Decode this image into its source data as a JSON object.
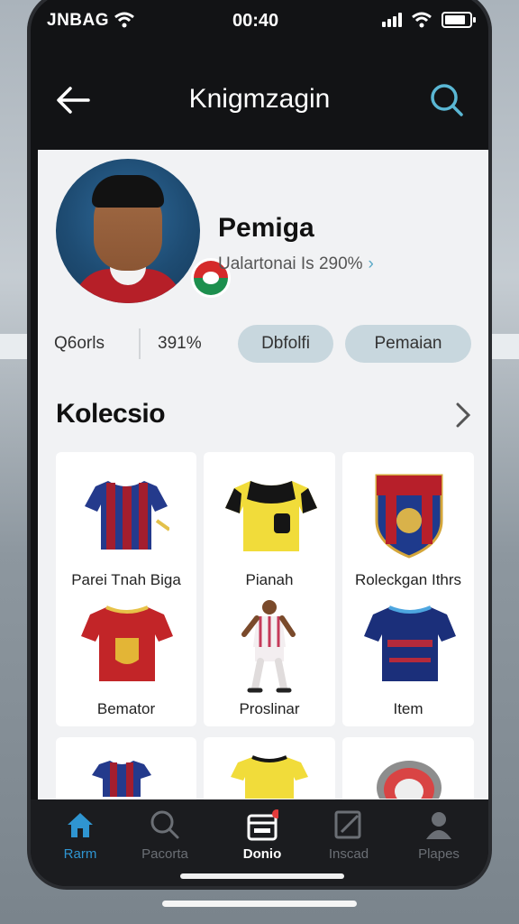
{
  "status_bar": {
    "carrier": "JNBAG",
    "time": "00:40"
  },
  "header": {
    "title": "Knigmzagin"
  },
  "profile": {
    "name": "Pemiga",
    "subtitle": "Ualartonai Is 290%",
    "stats": [
      {
        "value": "Q6orls"
      },
      {
        "value": "391%"
      }
    ],
    "buttons": [
      {
        "label": "Dbfolfi"
      },
      {
        "label": "Pemaian"
      }
    ]
  },
  "collection": {
    "title": "Kolecsio",
    "items": [
      {
        "label": "Parei Tnah Biga",
        "icon": "jersey-striped-icon"
      },
      {
        "label": "Pianah",
        "icon": "jersey-yellow-icon"
      },
      {
        "label": "Roleckgan Ithrs",
        "icon": "club-crest-icon"
      },
      {
        "label": "Bemator",
        "icon": "jersey-red-icon"
      },
      {
        "label": "Proslinar",
        "icon": "player-figure-icon"
      },
      {
        "label": "Item",
        "icon": "jersey-navy-icon"
      }
    ]
  },
  "tabbar": {
    "tabs": [
      {
        "label": "Rarm",
        "icon": "home-icon",
        "state": "active"
      },
      {
        "label": "Pacorta",
        "icon": "search-icon",
        "state": "normal"
      },
      {
        "label": "Donio",
        "icon": "calendar-icon",
        "state": "selected"
      },
      {
        "label": "Inscad",
        "icon": "edit-icon",
        "state": "normal"
      },
      {
        "label": "Plapes",
        "icon": "person-icon",
        "state": "normal"
      }
    ]
  },
  "colors": {
    "accent": "#2f95d1",
    "search_icon": "#5ab7d4",
    "pill_bg": "#c8d7de",
    "screen_bg": "#121315",
    "content_bg": "#f1f2f4"
  }
}
